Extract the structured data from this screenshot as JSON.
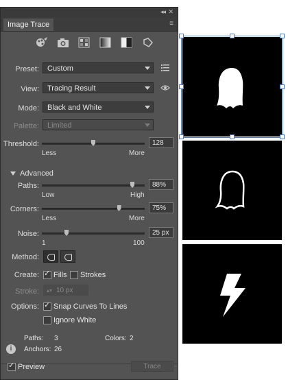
{
  "panel": {
    "title": "Image Trace",
    "collapse_glyph": "◂◂",
    "close_glyph": "✕",
    "menu_glyph": "≡",
    "preset_icons": [
      "auto-color-icon",
      "high-color-icon",
      "low-color-icon",
      "grayscale-icon",
      "black-white-icon",
      "outline-icon"
    ]
  },
  "form": {
    "preset_label": "Preset:",
    "preset_value": "Custom",
    "view_label": "View:",
    "view_value": "Tracing Result",
    "mode_label": "Mode:",
    "mode_value": "Black and White",
    "palette_label": "Palette:",
    "palette_value": "Limited",
    "threshold_label": "Threshold:",
    "threshold_value": "128",
    "threshold_level": 0.5,
    "threshold_min": "Less",
    "threshold_max": "More"
  },
  "advanced": {
    "title": "Advanced",
    "paths_label": "Paths:",
    "paths_value": "88%",
    "paths_level": 0.88,
    "paths_min": "Low",
    "paths_max": "High",
    "corners_label": "Corners:",
    "corners_value": "75%",
    "corners_level": 0.75,
    "corners_min": "Less",
    "corners_max": "More",
    "noise_label": "Noise:",
    "noise_value": "25 px",
    "noise_level": 0.24,
    "noise_min": "1",
    "noise_max": "100",
    "method_label": "Method:",
    "create_label": "Create:",
    "fills_label": "Fills",
    "fills_checked": true,
    "strokes_label": "Strokes",
    "strokes_checked": false,
    "stroke_label": "Stroke:",
    "stroke_value": "10 px",
    "options_label": "Options:",
    "snap_label": "Snap Curves To Lines",
    "snap_checked": true,
    "ignore_white_label": "Ignore White",
    "ignore_white_checked": false
  },
  "stats": {
    "paths_label": "Paths:",
    "paths_value": "3",
    "colors_label": "Colors:",
    "colors_value": "2",
    "anchors_label": "Anchors:",
    "anchors_value": "26"
  },
  "footer": {
    "preview_label": "Preview",
    "preview_checked": true,
    "trace_label": "Trace"
  },
  "colors": {
    "panel_bg": "#535353",
    "selection": "#4a7cd6"
  }
}
